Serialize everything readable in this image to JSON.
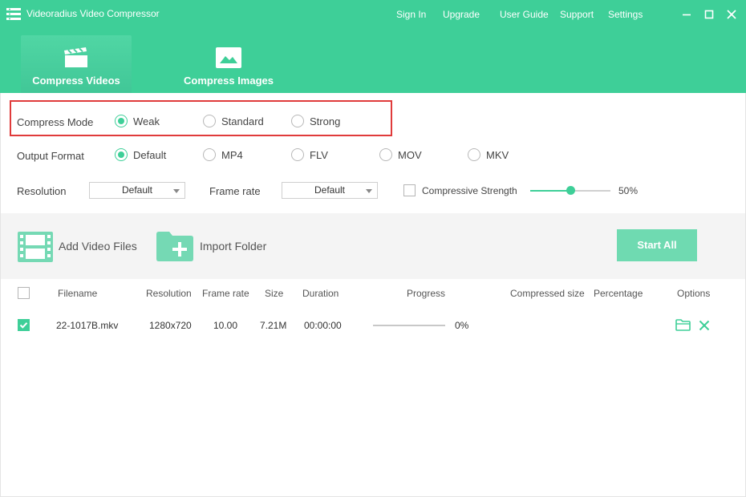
{
  "app": {
    "title": "Videoradius Video Compressor"
  },
  "topnav": [
    {
      "label": "Sign In"
    },
    {
      "label": "Upgrade"
    },
    {
      "label": "User Guide"
    },
    {
      "label": "Support"
    },
    {
      "label": "Settings"
    }
  ],
  "tabs": [
    {
      "label": "Compress Videos",
      "active": true
    },
    {
      "label": "Compress Images",
      "active": false
    }
  ],
  "compress_mode": {
    "label": "Compress Mode",
    "options": [
      "Weak",
      "Standard",
      "Strong"
    ],
    "selected": "Weak"
  },
  "output_format": {
    "label": "Output Format",
    "options": [
      "Default",
      "MP4",
      "FLV",
      "MOV",
      "MKV"
    ],
    "selected": "Default"
  },
  "resolution": {
    "label": "Resolution",
    "value": "Default"
  },
  "frame_rate": {
    "label": "Frame rate",
    "value": "Default"
  },
  "compressive_strength": {
    "label": "Compressive Strength",
    "checked": false,
    "value_text": "50%",
    "value": 50
  },
  "toolbar": {
    "add_files": "Add Video Files",
    "import_folder": "Import Folder",
    "start_all": "Start All"
  },
  "table": {
    "headers": {
      "filename": "Filename",
      "resolution": "Resolution",
      "frame_rate": "Frame rate",
      "size": "Size",
      "duration": "Duration",
      "progress": "Progress",
      "compressed_size": "Compressed size",
      "percentage": "Percentage",
      "options": "Options"
    },
    "rows": [
      {
        "checked": true,
        "filename": "22-1017B.mkv",
        "resolution": "1280x720",
        "frame_rate": "10.00",
        "size": "7.21M",
        "duration": "00:00:00",
        "progress_text": "0%",
        "progress": 0,
        "compressed_size": "",
        "percentage": ""
      }
    ]
  },
  "colors": {
    "accent": "#3ecf98",
    "button": "#6fdab1",
    "highlight": "#e03b3b"
  }
}
